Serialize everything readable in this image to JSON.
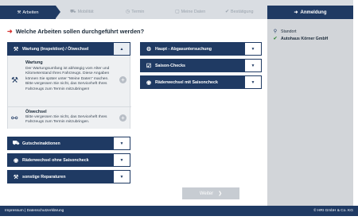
{
  "steps": [
    {
      "label": "Arbeiten",
      "icon": "wrench-icon",
      "active": true
    },
    {
      "label": "Mobilität",
      "icon": "car-icon",
      "active": false
    },
    {
      "label": "Termin",
      "icon": "clock-icon",
      "active": false
    },
    {
      "label": "Meine Daten",
      "icon": "user-icon",
      "active": false
    },
    {
      "label": "Bestätigung",
      "icon": "check-icon",
      "active": false
    }
  ],
  "login_label": "Anmeldung",
  "question": "Welche Arbeiten sollen durchgeführt werden?",
  "left_groups": {
    "wartung": {
      "label": "Wartung (Inspektion) / Ölwechsel",
      "options": [
        {
          "title": "Wartung",
          "desc": "Der Wartungsumfang ist abhängig vom Alter und Kilometerstand Ihres Fahrzeugs. Diese Angaben können Sie später unter \"Meine Daten\" machen. Bitte vergessen Sie nicht, das Serviceheft Ihres Fahrzeugs zum Termin mitzubringen!"
        },
        {
          "title": "Ölwechsel",
          "desc": "Bitte vergessen Sie nicht, das Serviceheft Ihres Fahrzeugs zum Termin mitzubringen."
        }
      ]
    },
    "gutscheinaktionen": {
      "label": "Gutscheinaktionen"
    },
    "raederwechsel_ohne": {
      "label": "Räderwechsel ohne Saisoncheck"
    },
    "sonstige": {
      "label": "sonstige Reparaturen"
    }
  },
  "right_groups": {
    "hu": {
      "label": "Haupt - Abgasuntersuchung"
    },
    "saison": {
      "label": "Saison-Checks"
    },
    "raederwechsel_mit": {
      "label": "Räderwechsel mit Saisoncheck"
    }
  },
  "next_label": "Weiter",
  "sidebar": {
    "location_label": "Standort",
    "location_value": "Autohaus Körner GmbH"
  },
  "footer": {
    "links": "Impressum | Datenschutzerklärung",
    "copyright": "© HRI GmbH & Co. KG"
  },
  "colors": {
    "primary": "#1f3a63",
    "accent": "#d6322e",
    "sidebar": "#d2d5d9",
    "success": "#3a8a3e"
  }
}
